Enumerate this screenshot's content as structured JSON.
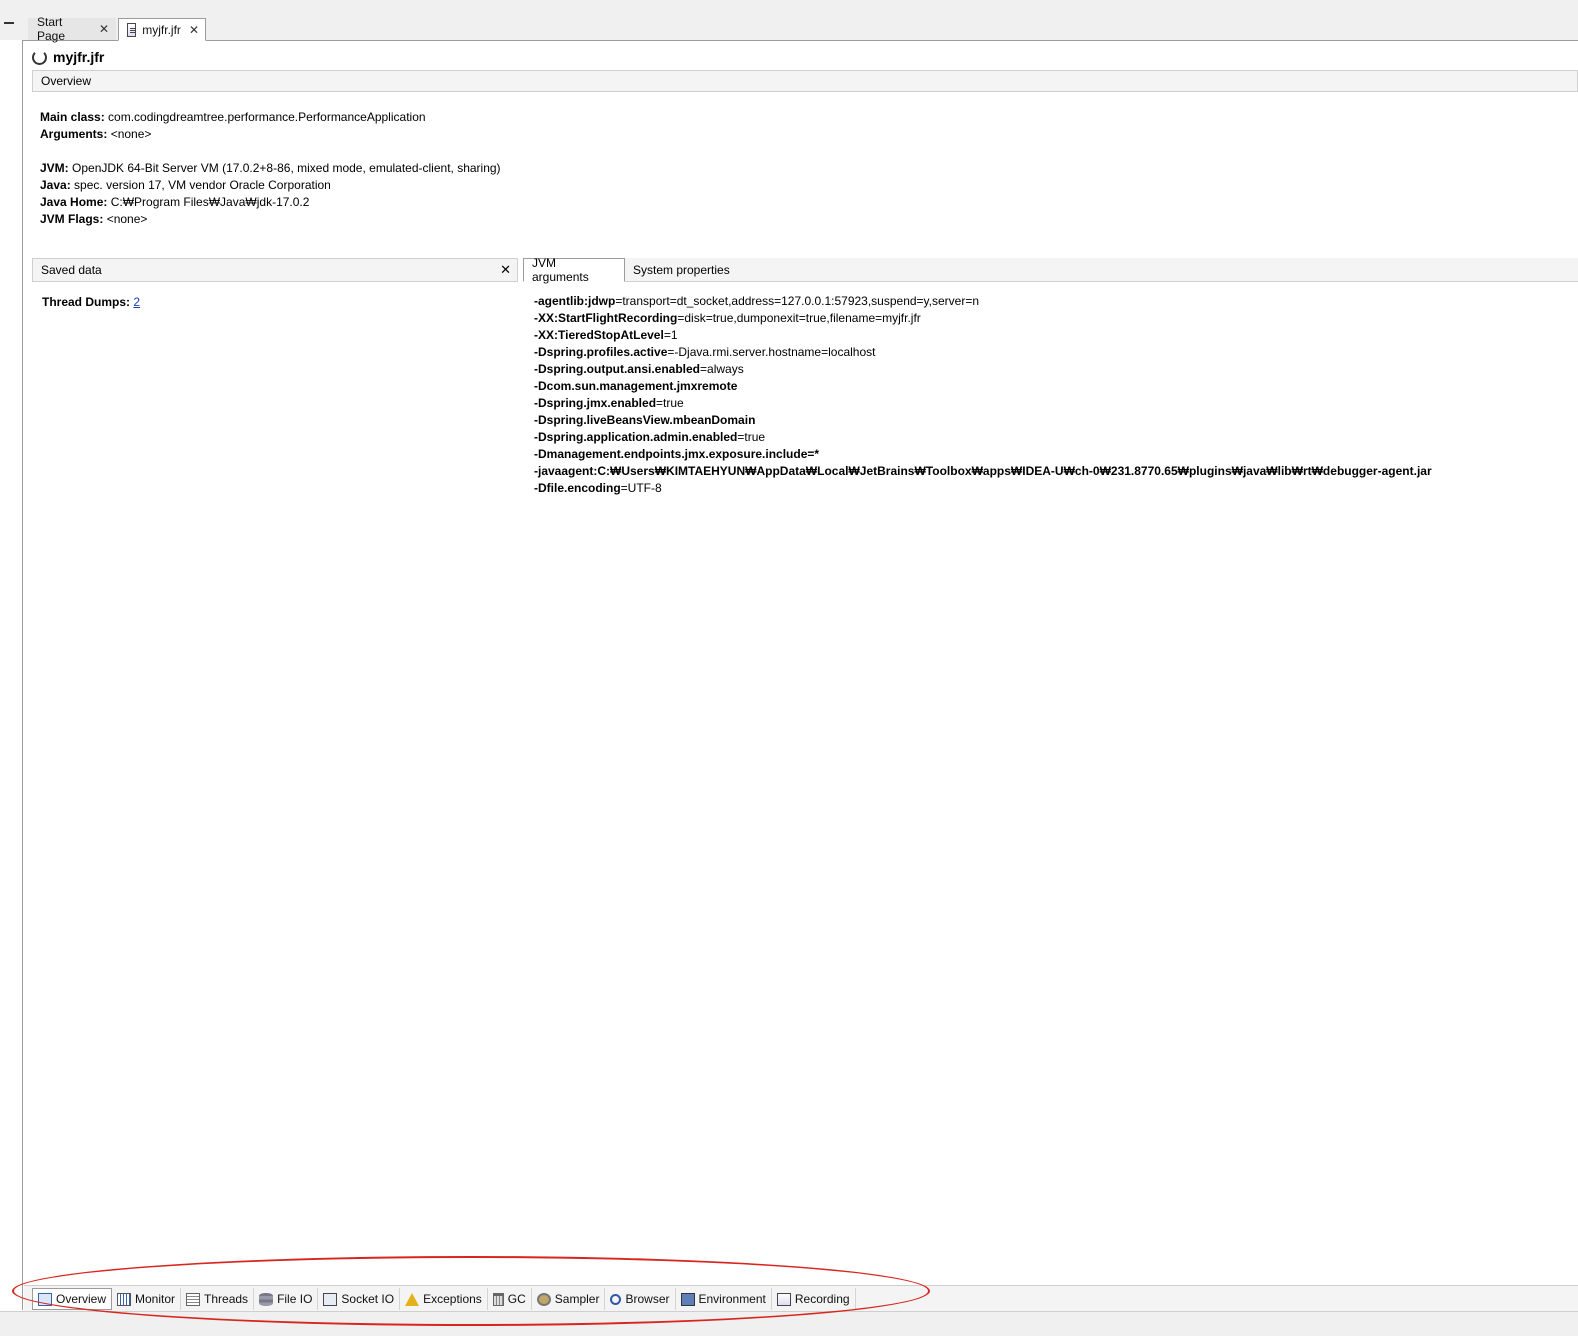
{
  "tabs": [
    {
      "label": "Start Page"
    },
    {
      "label": "myjfr.jfr"
    }
  ],
  "document": {
    "title": "myjfr.jfr"
  },
  "overview": {
    "header": "Overview",
    "main_class_label": "Main class:",
    "main_class_value": "com.codingdreamtree.performance.PerformanceApplication",
    "arguments_label": "Arguments:",
    "arguments_value": "<none>",
    "jvm_label": "JVM:",
    "jvm_value": "OpenJDK 64-Bit Server VM (17.0.2+8-86, mixed mode, emulated-client, sharing)",
    "java_label": "Java:",
    "java_value": "spec. version 17, VM vendor Oracle Corporation",
    "java_home_label": "Java Home:",
    "java_home_value": "C:₩Program Files₩Java₩jdk-17.0.2",
    "jvm_flags_label": "JVM Flags:",
    "jvm_flags_value": "<none>"
  },
  "saved_data": {
    "header": "Saved data",
    "thread_dumps_label": "Thread Dumps:",
    "thread_dumps_value": "2"
  },
  "jvm_panel": {
    "tabs": [
      "JVM arguments",
      "System properties"
    ],
    "args": [
      {
        "key": "-agentlib:jdwp",
        "value": "=transport=dt_socket,address=127.0.0.1:57923,suspend=y,server=n"
      },
      {
        "key": "-XX:StartFlightRecording",
        "value": "=disk=true,dumponexit=true,filename=myjfr.jfr"
      },
      {
        "key": "-XX:TieredStopAtLevel",
        "value": "=1"
      },
      {
        "key": "-Dspring.profiles.active",
        "value": "=-Djava.rmi.server.hostname=localhost"
      },
      {
        "key": "-Dspring.output.ansi.enabled",
        "value": "=always"
      },
      {
        "key": "-Dcom.sun.management.jmxremote",
        "value": ""
      },
      {
        "key": "-Dspring.jmx.enabled",
        "value": "=true"
      },
      {
        "key": "-Dspring.liveBeansView.mbeanDomain",
        "value": ""
      },
      {
        "key": "-Dspring.application.admin.enabled",
        "value": "=true"
      },
      {
        "key": "-Dmanagement.endpoints.jmx.exposure.include=*",
        "value": ""
      },
      {
        "key": "-javaagent:C:₩Users₩KIMTAEHYUN₩AppData₩Local₩JetBrains₩Toolbox₩apps₩IDEA-U₩ch-0₩231.8770.65₩plugins₩java₩lib₩rt₩debugger-agent.jar",
        "value": ""
      },
      {
        "key": "-Dfile.encoding",
        "value": "=UTF-8"
      }
    ]
  },
  "bottom_tabs": [
    {
      "label": "Overview",
      "icon": "overview-icon"
    },
    {
      "label": "Monitor",
      "icon": "monitor-icon"
    },
    {
      "label": "Threads",
      "icon": "threads-icon"
    },
    {
      "label": "File IO",
      "icon": "file-io-icon"
    },
    {
      "label": "Socket IO",
      "icon": "socket-io-icon"
    },
    {
      "label": "Exceptions",
      "icon": "exceptions-icon"
    },
    {
      "label": "GC",
      "icon": "gc-icon"
    },
    {
      "label": "Sampler",
      "icon": "sampler-icon"
    },
    {
      "label": "Browser",
      "icon": "browser-icon"
    },
    {
      "label": "Environment",
      "icon": "environment-icon"
    },
    {
      "label": "Recording",
      "icon": "recording-icon"
    }
  ],
  "colors": {
    "link": "#1a3eb8",
    "annotation": "#d8261f"
  }
}
